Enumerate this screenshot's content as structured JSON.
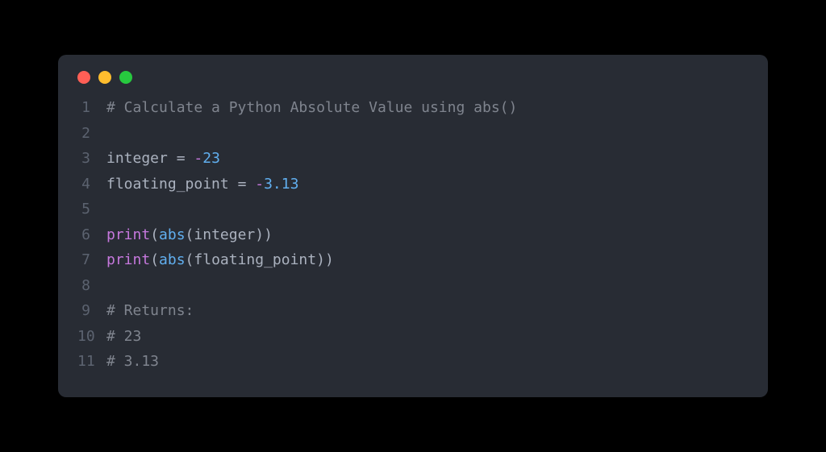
{
  "code": {
    "lines": [
      {
        "n": "1",
        "tokens": [
          {
            "t": "# Calculate a Python Absolute Value using abs()",
            "c": "comment"
          }
        ]
      },
      {
        "n": "2",
        "tokens": []
      },
      {
        "n": "3",
        "tokens": [
          {
            "t": "integer ",
            "c": "ident"
          },
          {
            "t": "=",
            "c": "op"
          },
          {
            "t": " ",
            "c": "ident"
          },
          {
            "t": "-",
            "c": "minus"
          },
          {
            "t": "23",
            "c": "number"
          }
        ]
      },
      {
        "n": "4",
        "tokens": [
          {
            "t": "floating_point ",
            "c": "ident"
          },
          {
            "t": "=",
            "c": "op"
          },
          {
            "t": " ",
            "c": "ident"
          },
          {
            "t": "-",
            "c": "minus"
          },
          {
            "t": "3.13",
            "c": "number"
          }
        ]
      },
      {
        "n": "5",
        "tokens": []
      },
      {
        "n": "6",
        "tokens": [
          {
            "t": "print",
            "c": "builtin"
          },
          {
            "t": "(",
            "c": "punct"
          },
          {
            "t": "abs",
            "c": "func"
          },
          {
            "t": "(",
            "c": "punct"
          },
          {
            "t": "integer",
            "c": "ident"
          },
          {
            "t": "))",
            "c": "punct"
          }
        ]
      },
      {
        "n": "7",
        "tokens": [
          {
            "t": "print",
            "c": "builtin"
          },
          {
            "t": "(",
            "c": "punct"
          },
          {
            "t": "abs",
            "c": "func"
          },
          {
            "t": "(",
            "c": "punct"
          },
          {
            "t": "floating_point",
            "c": "ident"
          },
          {
            "t": "))",
            "c": "punct"
          }
        ]
      },
      {
        "n": "8",
        "tokens": []
      },
      {
        "n": "9",
        "tokens": [
          {
            "t": "# Returns:",
            "c": "comment"
          }
        ]
      },
      {
        "n": "10",
        "tokens": [
          {
            "t": "# 23",
            "c": "comment"
          }
        ]
      },
      {
        "n": "11",
        "tokens": [
          {
            "t": "# 3.13",
            "c": "comment"
          }
        ]
      }
    ]
  }
}
